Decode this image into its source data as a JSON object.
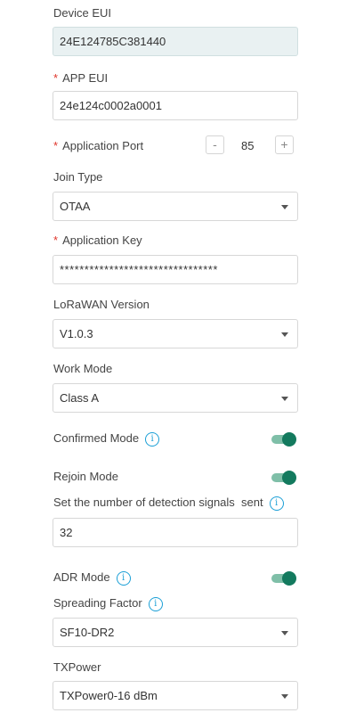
{
  "device_eui": {
    "label": "Device EUI",
    "value": "24E124785C381440"
  },
  "app_eui": {
    "label": "APP EUI",
    "value": "24e124c0002a0001",
    "required": "*"
  },
  "application_port": {
    "label": "Application Port",
    "value": "85",
    "minus": "-",
    "plus": "+",
    "required": "*"
  },
  "join_type": {
    "label": "Join Type",
    "value": "OTAA"
  },
  "application_key": {
    "label": "Application Key",
    "value": "********************************",
    "required": "*"
  },
  "lorawan_version": {
    "label": "LoRaWAN Version",
    "value": "V1.0.3"
  },
  "work_mode": {
    "label": "Work Mode",
    "value": "Class A"
  },
  "confirmed_mode": {
    "label": "Confirmed Mode",
    "enabled": true
  },
  "rejoin_mode": {
    "label": "Rejoin Mode",
    "enabled": true
  },
  "detection_signals": {
    "label": "Set the number of detection signals  sent",
    "value": "32"
  },
  "adr_mode": {
    "label": "ADR Mode",
    "enabled": true
  },
  "spreading_factor": {
    "label": "Spreading Factor",
    "value": "SF10-DR2"
  },
  "txpower": {
    "label": "TXPower",
    "value": "TXPower0-16 dBm"
  },
  "info_glyph": "i",
  "colors": {
    "accent": "#137a5e",
    "info": "#1a9fd6",
    "required": "#e0352b"
  },
  "icons": [
    "info-icon",
    "chevron-down-icon",
    "toggle-switch"
  ]
}
